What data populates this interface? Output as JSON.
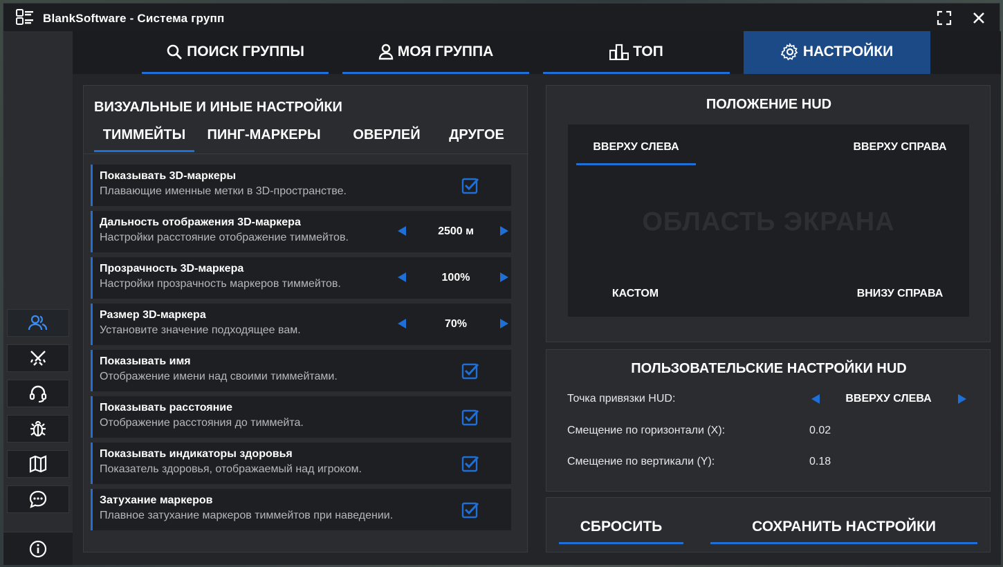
{
  "window": {
    "title": "BlankSoftware - Система групп"
  },
  "nav": {
    "tabs": [
      {
        "label": "ПОИСК ГРУППЫ",
        "icon": "search-icon"
      },
      {
        "label": "МОЯ ГРУППА",
        "icon": "user-icon"
      },
      {
        "label": "ТОП",
        "icon": "leaderboard-icon"
      },
      {
        "label": "НАСТРОЙКИ",
        "icon": "gear-icon",
        "active": true
      }
    ]
  },
  "sidebar": {
    "items": [
      {
        "icon": "users-icon"
      },
      {
        "icon": "crossed-swords-icon"
      },
      {
        "icon": "headset-icon"
      },
      {
        "icon": "bug-icon"
      },
      {
        "icon": "map-icon"
      },
      {
        "icon": "chat-icon"
      }
    ],
    "bottom_icon": "info-icon"
  },
  "visual": {
    "title": "ВИЗУАЛЬНЫЕ И ИНЫЕ НАСТРОЙКИ",
    "tabs": [
      "ТИММЕЙТЫ",
      "ПИНГ-МАРКЕРЫ",
      "ОВЕРЛЕЙ",
      "ДРУГОЕ"
    ],
    "settings": [
      {
        "label": "Показывать 3D-маркеры",
        "desc": "Плавающие именные метки в 3D-пространстве.",
        "type": "checkbox",
        "checked": true
      },
      {
        "label": "Дальность отображения 3D-маркера",
        "desc": "Настройки расстояние отображение тиммейтов.",
        "type": "stepper",
        "value": "2500 м"
      },
      {
        "label": "Прозрачность 3D-маркера",
        "desc": "Настройки прозрачность маркеров тиммейтов.",
        "type": "stepper",
        "value": "100%"
      },
      {
        "label": "Размер 3D-маркера",
        "desc": "Установите значение подходящее вам.",
        "type": "stepper",
        "value": "70%"
      },
      {
        "label": "Показывать имя",
        "desc": "Отображение имени над своими тиммейтами.",
        "type": "checkbox",
        "checked": true
      },
      {
        "label": "Показывать расстояние",
        "desc": "Отображение расстояния до тиммейта.",
        "type": "checkbox",
        "checked": true
      },
      {
        "label": "Показывать индикаторы здоровья",
        "desc": "Показатель здоровья, отображаемый над игроком.",
        "type": "checkbox",
        "checked": true
      },
      {
        "label": "Затухание маркеров",
        "desc": "Плавное затухание маркеров тиммейтов при наведении.",
        "type": "checkbox",
        "checked": true
      }
    ]
  },
  "hud": {
    "title": "ПОЛОЖЕНИЕ HUD",
    "screen_area": "ОБЛАСТЬ ЭКРАНА",
    "options": {
      "top_left": "ВВЕРХУ СЛЕВА",
      "top_right": "ВВЕРХУ СПРАВА",
      "custom": "КАСТОМ",
      "bottom_right": "ВНИЗУ СПРАВА"
    }
  },
  "custom_hud": {
    "title": "ПОЛЬЗОВАТЕЛЬСКИЕ НАСТРОЙКИ HUD",
    "anchor_label": "Точка привязки HUD:",
    "anchor_value": "ВВЕРХУ СЛЕВА",
    "x_label": "Смещение по горизонтали (X):",
    "x_value": "0.02",
    "y_label": "Смещение по вертикали (Y):",
    "y_value": "0.18"
  },
  "actions": {
    "reset": "СБРОСИТЬ",
    "save": "СОХРАНИТЬ НАСТРОЙКИ"
  },
  "colors": {
    "accent": "#1f6fd9",
    "active_tab": "#1b4a86",
    "panel": "#2a2c30",
    "row": "#1d1f22"
  }
}
